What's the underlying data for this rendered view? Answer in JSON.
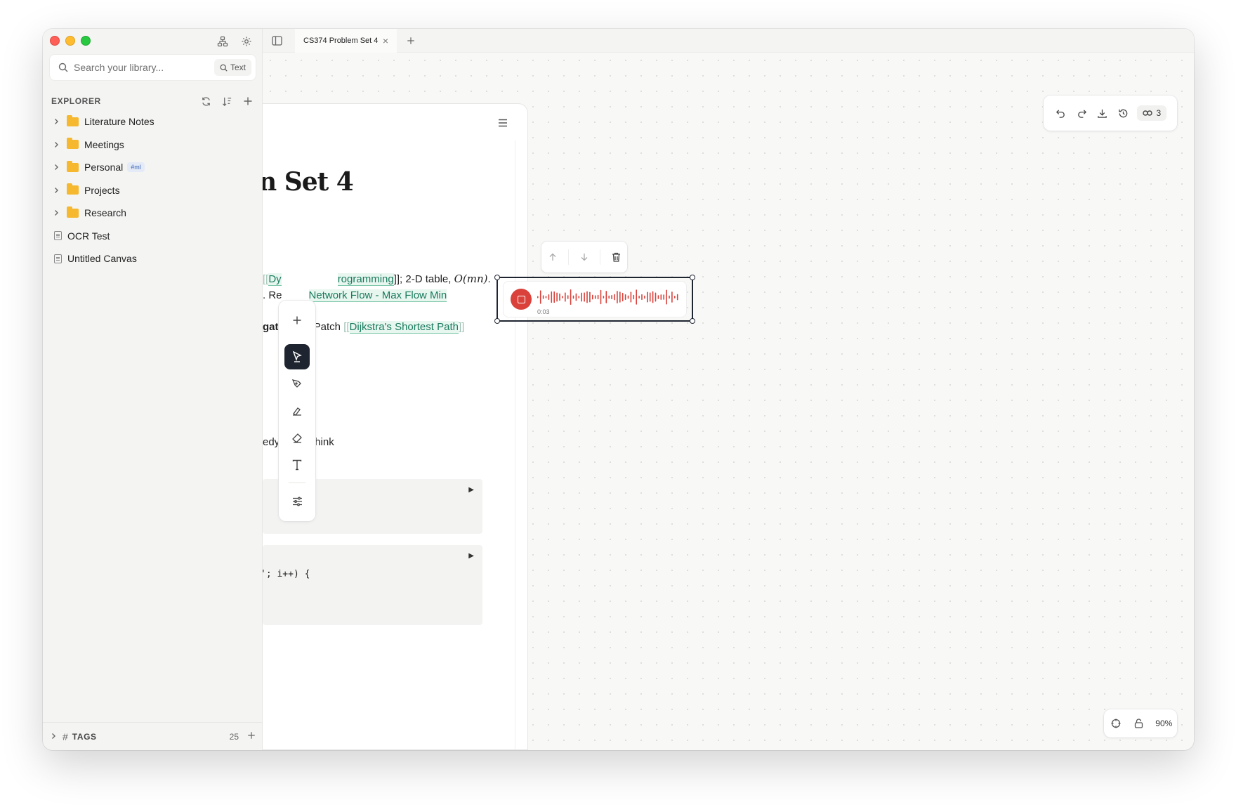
{
  "tab": {
    "title": "CS374 Problem Set 4"
  },
  "search": {
    "placeholder": "Search your library...",
    "mode": "Text"
  },
  "explorer": {
    "title": "EXPLORER",
    "folders": [
      {
        "label": "Literature Notes"
      },
      {
        "label": "Meetings"
      },
      {
        "label": "Personal",
        "tag": "#ml"
      },
      {
        "label": "Projects"
      },
      {
        "label": "Research"
      }
    ],
    "files": [
      {
        "label": "OCR Test"
      },
      {
        "label": "Untitled Canvas"
      }
    ]
  },
  "tags": {
    "label": "TAGS",
    "count": "25"
  },
  "toolbar": {
    "link_count": "3"
  },
  "zoom": {
    "level": "90%"
  },
  "document": {
    "title": "n Set 4",
    "line1": {
      "pre": "[[",
      "link": "Dy",
      "mid": "rogramming",
      "post": "]]; 2-D table, ",
      "math": "O(mn)",
      "end": "."
    },
    "line2": {
      "pre": ". Re",
      "link": "Network Flow - Max Flow Min"
    },
    "line3": {
      "pre": "gati",
      "mid": "Patch ",
      "link": "Dijkstra's Shortest Path"
    },
    "line4": {
      "pre": "edy",
      "post": "hink"
    },
    "code2": "'; i++) {"
  },
  "audio": {
    "time": "0:03"
  },
  "colors": {
    "accent": "#1f2530",
    "record": "#d9413a",
    "folder": "#f5b82e",
    "link": "#1a7a5e"
  }
}
